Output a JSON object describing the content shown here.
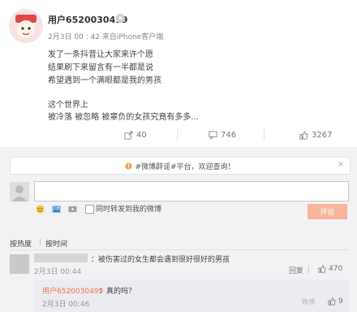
{
  "post": {
    "username": "用户6520030499",
    "vip_badge": "♦",
    "meta": "2月3日 00 : 42 来自iPhone客户端",
    "lines": [
      "发了一条抖音让大家来许个愿",
      "结果刷下来留言有一半都是说",
      "希望遇到一个满眼都是我的男孩",
      "",
      "这个世界上",
      "被冷落 被忽略 被辜负的女孩究竟有多多..."
    ],
    "actions": {
      "share_count": "40",
      "comment_count": "746",
      "like_count": "3267"
    }
  },
  "comments": {
    "notice": "#微博辟谣#平台，欢迎查询！",
    "notice_close": "×",
    "share_label": "同时转发到我的微博",
    "submit_label": "评论",
    "tabs": [
      "按热度",
      "按时间"
    ],
    "tab_separator": "|",
    "items": [
      {
        "text": "：被伤害过的女生都会遇到很好很好的男孩",
        "time": "2月3日 00:44",
        "reply_label": "回复",
        "like_count": "470"
      }
    ],
    "reply": {
      "user": "用户6520030499",
      "text": "：真的吗？",
      "time": "2月3日 00:46",
      "like_count": "9"
    },
    "watermark": "微博"
  },
  "colors": {
    "accent": "#eb7350",
    "submit_bg": "#f7b69b",
    "comment_bg": "#f2f2f5"
  },
  "icons": [
    "share-icon",
    "comment-icon",
    "like-icon",
    "emoji-icon",
    "image-icon",
    "video-icon",
    "info-icon",
    "close-icon"
  ]
}
